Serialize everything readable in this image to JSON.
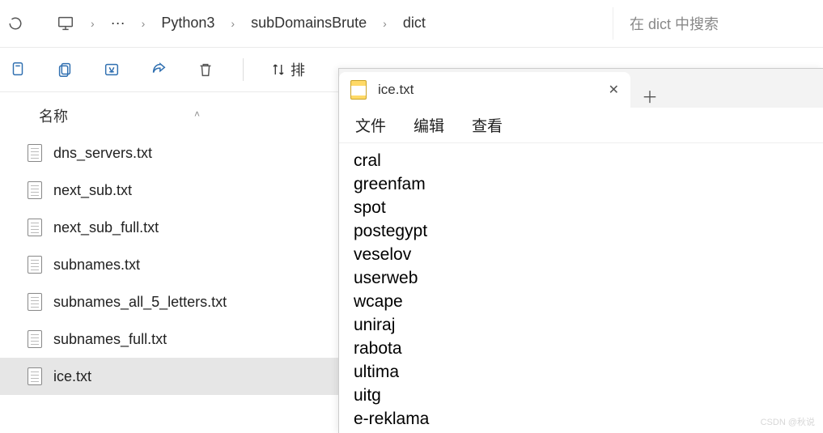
{
  "breadcrumb": {
    "items": [
      "Python3",
      "subDomainsBrute",
      "dict"
    ]
  },
  "search": {
    "placeholder": "在 dict 中搜索"
  },
  "toolbar": {
    "sort_label": "排"
  },
  "columns": {
    "name": "名称"
  },
  "files": [
    {
      "name": "dns_servers.txt",
      "selected": false
    },
    {
      "name": "next_sub.txt",
      "selected": false
    },
    {
      "name": "next_sub_full.txt",
      "selected": false
    },
    {
      "name": "subnames.txt",
      "selected": false
    },
    {
      "name": "subnames_all_5_letters.txt",
      "selected": false
    },
    {
      "name": "subnames_full.txt",
      "selected": false
    },
    {
      "name": "ice.txt",
      "selected": true
    }
  ],
  "notepad": {
    "tab_title": "ice.txt",
    "menu": {
      "file": "文件",
      "edit": "编辑",
      "view": "查看"
    },
    "lines": [
      "cral",
      "greenfam",
      "spot",
      "postegypt",
      "veselov",
      "userweb",
      "wcape",
      "uniraj",
      "rabota",
      "ultima",
      "uitg",
      "e-reklama"
    ]
  },
  "watermark": "CSDN @秋说"
}
